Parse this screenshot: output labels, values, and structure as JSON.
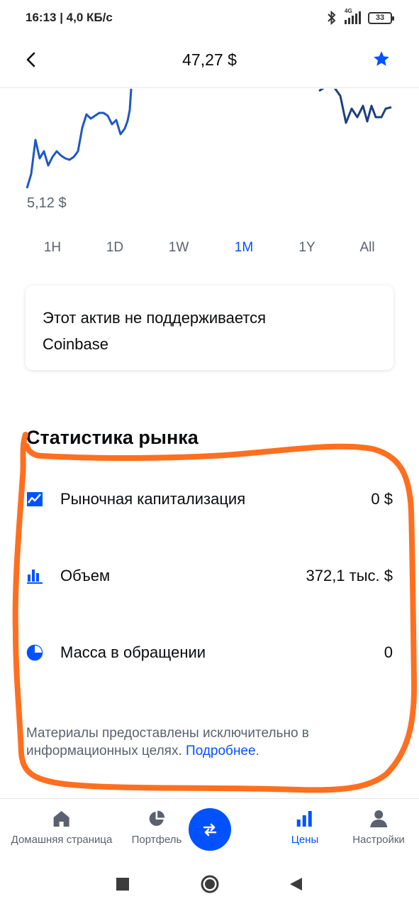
{
  "status_bar": {
    "time_speed": "16:13 | 4,0 КБ/с",
    "network": "4G",
    "battery": "33"
  },
  "header": {
    "price": "47,27 $",
    "accent_color": "#0052ff"
  },
  "chart": {
    "min_label": "5,12 $",
    "line_color": "#0052ff",
    "ranges": [
      {
        "label": "1H",
        "active": false
      },
      {
        "label": "1D",
        "active": false
      },
      {
        "label": "1W",
        "active": false
      },
      {
        "label": "1M",
        "active": true
      },
      {
        "label": "1Y",
        "active": false
      },
      {
        "label": "All",
        "active": false
      }
    ]
  },
  "notice": {
    "line1": "Этот актив не поддерживается",
    "line2": "Coinbase"
  },
  "stats": {
    "title": "Статистика рынка",
    "rows": [
      {
        "icon": "market-cap-chart-icon",
        "label": "Рыночная капитализация",
        "value": "0 $"
      },
      {
        "icon": "volume-bars-icon",
        "label": "Объем",
        "value": "372,1 тыс. $"
      },
      {
        "icon": "circulating-supply-pie-icon",
        "label": "Масса в обращении",
        "value": "0"
      }
    ]
  },
  "disclaimer": {
    "text": "Материалы предоставлены исключительно в информационных целях. ",
    "link": "Подробнее",
    "end": "."
  },
  "bottom_nav": {
    "items": [
      {
        "label": "Домашняя страница",
        "icon": "home-icon",
        "active": false
      },
      {
        "label": "Портфель",
        "icon": "portfolio-pie-icon",
        "active": false
      },
      {
        "label": "",
        "icon": "trade-swap-icon",
        "active": false
      },
      {
        "label": "Цены",
        "icon": "prices-bars-icon",
        "active": true
      },
      {
        "label": "Настройки",
        "icon": "person-icon",
        "active": false
      }
    ]
  },
  "annotation_color": "#ff6f1f"
}
